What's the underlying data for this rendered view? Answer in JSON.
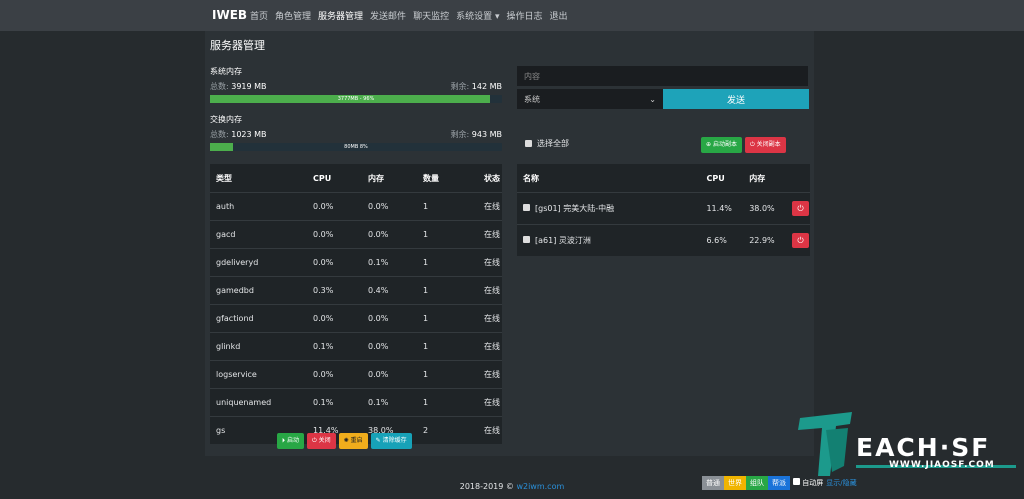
{
  "nav": {
    "brand": "IWEB",
    "items": [
      "首页",
      "角色管理",
      "服务器管理",
      "发送邮件",
      "聊天监控",
      "系统设置 ▾",
      "操作日志",
      "退出"
    ]
  },
  "page_title": "服务器管理",
  "system_memory": {
    "title": "系统内存",
    "total_label": "总数:",
    "total_value": "3919 MB",
    "free_label": "剩余:",
    "free_value": "142 MB",
    "bar_text": "3777MB - 96%",
    "fill_percent": 96
  },
  "swap_memory": {
    "title": "交换内存",
    "total_label": "总数:",
    "total_value": "1023 MB",
    "free_label": "剩余:",
    "free_value": "943 MB",
    "bar_text": "80MB  8%",
    "fill_percent": 8
  },
  "process_table": {
    "headers": [
      "类型",
      "CPU",
      "内存",
      "数量",
      "状态"
    ],
    "rows": [
      [
        "auth",
        "0.0%",
        "0.0%",
        "1",
        "在线"
      ],
      [
        "gacd",
        "0.0%",
        "0.0%",
        "1",
        "在线"
      ],
      [
        "gdeliveryd",
        "0.0%",
        "0.1%",
        "1",
        "在线"
      ],
      [
        "gamedbd",
        "0.3%",
        "0.4%",
        "1",
        "在线"
      ],
      [
        "gfactiond",
        "0.0%",
        "0.0%",
        "1",
        "在线"
      ],
      [
        "glinkd",
        "0.1%",
        "0.0%",
        "1",
        "在线"
      ],
      [
        "logservice",
        "0.0%",
        "0.0%",
        "1",
        "在线"
      ],
      [
        "uniquenamed",
        "0.1%",
        "0.1%",
        "1",
        "在线"
      ],
      [
        "gs",
        "11.4%",
        "38.0%",
        "2",
        "在线"
      ]
    ]
  },
  "actions": {
    "start": "启动",
    "stop": "关闭",
    "restart": "重启",
    "clear_cache": "清除缓存"
  },
  "message": {
    "placeholder": "内容",
    "select_value": "系统",
    "send": "发送"
  },
  "instances": {
    "select_all": "选择全部",
    "start_instance": "启动副本",
    "stop_instance": "关闭副本",
    "headers": [
      "名称",
      "CPU",
      "内存"
    ],
    "rows": [
      [
        "[gs01] 完美大陆-中融",
        "11.4%",
        "38.0%"
      ],
      [
        "[a61] 灵波汀洲",
        "6.6%",
        "22.9%"
      ]
    ]
  },
  "footer": {
    "text": "2018-2019 ©",
    "link": "w2iwm.com"
  },
  "theme_bar": {
    "swatches": [
      {
        "label": "普通",
        "color": "#8a9096"
      },
      {
        "label": "世界",
        "color": "#f0b400"
      },
      {
        "label": "组队",
        "color": "#28a745"
      },
      {
        "label": "帮派",
        "color": "#1a73d9"
      }
    ],
    "auto_label": "自动",
    "auto_suffix": "屏",
    "show_hide": "显示/隐藏"
  },
  "watermark": {
    "text": "EACH·SF",
    "sub": "WWW.JIAOSF.COM"
  },
  "colors": {
    "accent_cyan": "#17a2b8",
    "online": "#3cb04a",
    "danger": "#dc3545",
    "success": "#28a745"
  }
}
